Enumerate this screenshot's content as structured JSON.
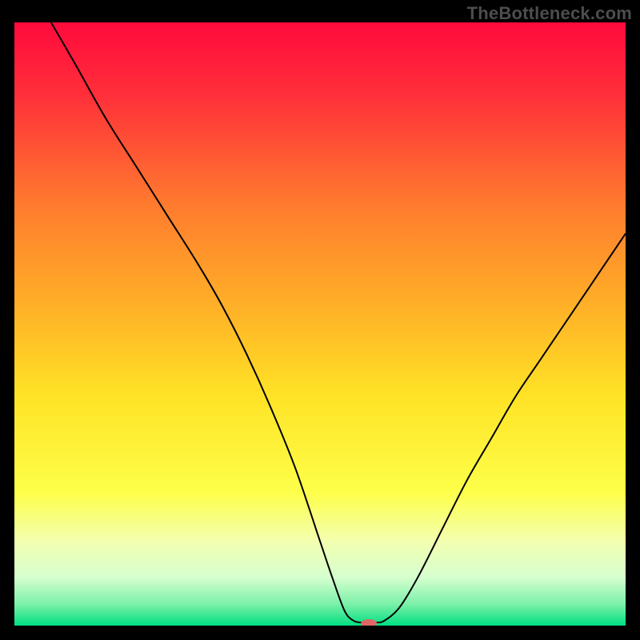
{
  "watermark": "TheBottleneck.com",
  "chart_data": {
    "type": "line",
    "title": "",
    "xlabel": "",
    "ylabel": "",
    "xlim": [
      0,
      100
    ],
    "ylim": [
      0,
      100
    ],
    "grid": false,
    "legend": false,
    "background": {
      "type": "vertical-gradient",
      "stops": [
        {
          "offset": 0.0,
          "color": "#ff0a3c"
        },
        {
          "offset": 0.12,
          "color": "#ff2f3a"
        },
        {
          "offset": 0.3,
          "color": "#ff7a2e"
        },
        {
          "offset": 0.48,
          "color": "#ffb327"
        },
        {
          "offset": 0.62,
          "color": "#ffe326"
        },
        {
          "offset": 0.78,
          "color": "#fdff4a"
        },
        {
          "offset": 0.86,
          "color": "#f3ffb0"
        },
        {
          "offset": 0.92,
          "color": "#d6ffcf"
        },
        {
          "offset": 0.965,
          "color": "#7af0a8"
        },
        {
          "offset": 1.0,
          "color": "#00e081"
        }
      ]
    },
    "series": [
      {
        "name": "bottleneck-curve",
        "color": "#000000",
        "stroke_width": 2,
        "x": [
          6,
          10,
          15,
          20,
          25,
          30,
          34,
          38,
          42,
          46,
          50,
          52,
          54,
          55.5,
          57,
          59,
          60.5,
          63,
          66,
          70,
          74,
          78,
          82,
          86,
          90,
          94,
          98,
          100
        ],
        "y": [
          100,
          93,
          84,
          76,
          68,
          60,
          53,
          45,
          36,
          26,
          14,
          8,
          2.5,
          0.8,
          0.5,
          0.5,
          0.8,
          3,
          8,
          16,
          24,
          31,
          38,
          44,
          50,
          56,
          62,
          65
        ]
      }
    ],
    "marker": {
      "name": "optimal-point",
      "x": 58,
      "y": 0.4,
      "color": "#e06666",
      "rx": 10,
      "ry": 5
    }
  }
}
